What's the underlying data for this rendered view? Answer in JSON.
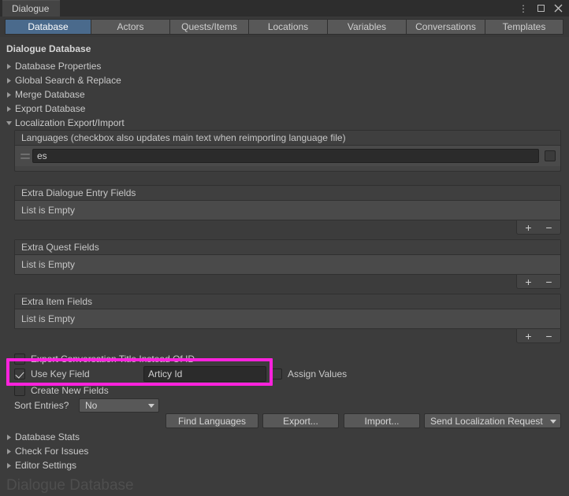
{
  "window": {
    "tab_label": "Dialogue",
    "icons": {
      "menu": "kebab-menu-icon",
      "maximize": "maximize-icon",
      "close": "close-icon"
    }
  },
  "tabs": [
    {
      "label": "Database",
      "selected": true
    },
    {
      "label": "Actors",
      "selected": false
    },
    {
      "label": "Quests/Items",
      "selected": false
    },
    {
      "label": "Locations",
      "selected": false
    },
    {
      "label": "Variables",
      "selected": false
    },
    {
      "label": "Conversations",
      "selected": false
    },
    {
      "label": "Templates",
      "selected": false
    }
  ],
  "main": {
    "heading": "Dialogue Database",
    "foldouts_top": [
      {
        "label": "Database Properties",
        "expanded": false
      },
      {
        "label": "Global Search & Replace",
        "expanded": false
      },
      {
        "label": "Merge Database",
        "expanded": false
      },
      {
        "label": "Export Database",
        "expanded": false
      },
      {
        "label": "Localization Export/Import",
        "expanded": true
      }
    ],
    "languages": {
      "header": "Languages (checkbox also updates main text when reimporting language file)",
      "rows": [
        {
          "value": "es",
          "checked": false
        }
      ],
      "add_label": "+",
      "remove_label": "−"
    },
    "extra_lists": [
      {
        "header": "Extra Dialogue Entry Fields",
        "empty_text": "List is Empty",
        "add_label": "+",
        "remove_label": "−"
      },
      {
        "header": "Extra Quest Fields",
        "empty_text": "List is Empty",
        "add_label": "+",
        "remove_label": "−"
      },
      {
        "header": "Extra Item Fields",
        "empty_text": "List is Empty",
        "add_label": "+",
        "remove_label": "−"
      }
    ],
    "options": {
      "export_conversation_title": {
        "label": "Export Conversation Title Instead Of ID",
        "checked": false
      },
      "use_key_field": {
        "label": "Use Key Field",
        "checked": true
      },
      "key_field_value": "Articy Id",
      "assign_values": {
        "label": "Assign Values",
        "checked": false
      },
      "create_new_fields": {
        "label": "Create New Fields",
        "checked": false
      },
      "sort_entries_label": "Sort Entries?",
      "sort_entries_value": "No"
    },
    "actions": [
      {
        "label": "Find Languages"
      },
      {
        "label": "Export..."
      },
      {
        "label": "Import..."
      }
    ],
    "localization_request": {
      "label": "Send Localization Request"
    },
    "foldouts_bottom": [
      {
        "label": "Database Stats",
        "expanded": false
      },
      {
        "label": "Check For Issues",
        "expanded": false
      },
      {
        "label": "Editor Settings",
        "expanded": false
      }
    ],
    "watermark": "Dialogue Database"
  },
  "annotation": {
    "highlight_color": "#ff22dd"
  }
}
